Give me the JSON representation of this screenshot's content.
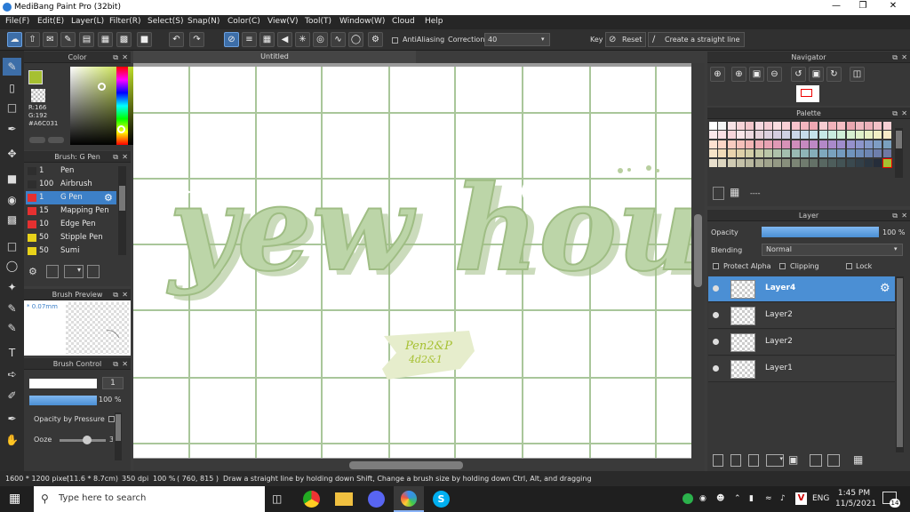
{
  "window": {
    "title": "MediBang Paint Pro (32bit)"
  },
  "menu": [
    "File(F)",
    "Edit(E)",
    "Layer(L)",
    "Filter(R)",
    "Select(S)",
    "Snap(N)",
    "Color(C)",
    "View(V)",
    "Tool(T)",
    "Window(W)",
    "Cloud",
    "Help"
  ],
  "toolbar": {
    "antialiasing_label": "AntiAliasing",
    "correction_label": "Correction",
    "correction_value": "40",
    "key_label": "Key",
    "reset_label": "Reset",
    "straight_line_label": "Create a straight line"
  },
  "color_panel": {
    "title": "Color",
    "r": "R:166",
    "g": "G:192",
    "hex": "#A6C031",
    "current_color": "#a6c031"
  },
  "brush_panel": {
    "title": "Brush: G Pen",
    "items": [
      {
        "size": "1",
        "name": "Pen",
        "color": "#2e2e2e"
      },
      {
        "size": "100",
        "name": "Airbrush",
        "color": "#2e2e2e"
      },
      {
        "size": "1",
        "name": "G Pen",
        "color": "#e53030"
      },
      {
        "size": "15",
        "name": "Mapping Pen",
        "color": "#e53030"
      },
      {
        "size": "10",
        "name": "Edge Pen",
        "color": "#e53030"
      },
      {
        "size": "50",
        "name": "Stipple Pen",
        "color": "#e8d21a"
      },
      {
        "size": "50",
        "name": "Sumi",
        "color": "#e8d21a"
      }
    ]
  },
  "brush_preview": {
    "title": "Brush Preview",
    "size": "* 0.07mm"
  },
  "brush_control": {
    "title": "Brush Control",
    "size_value": "1",
    "opacity_value": "100 %",
    "opacity_pressure_label": "Opacity by Pressure",
    "ooze_label": "Ooze",
    "ooze_value": "3"
  },
  "document": {
    "tab_title": "Untitled",
    "artwork_text": "yew hou",
    "sticker_line1": "Pen2&P",
    "sticker_line2": "4d2&1"
  },
  "navigator": {
    "title": "Navigator"
  },
  "palette": {
    "title": "Palette",
    "dash": "----",
    "colors": [
      "#ffffff",
      "#f4f4f4",
      "#f8e3e6",
      "#f7d4d8",
      "#f3c6cb",
      "#f6d8e0",
      "#f4ccd4",
      "#fadce0",
      "#f9d0d6",
      "#f7c4cc",
      "#f3b6bf",
      "#f0a8b3",
      "#f8cdd2",
      "#f2b3bb",
      "#f5bec4",
      "#eaa7b0",
      "#f0b8c0",
      "#ecb0b9",
      "#f2c1c7",
      "#f6cfd4",
      "#fbe8ea",
      "#f9dfe3",
      "#f6d5da",
      "#f9e6e9",
      "#ecd9df",
      "#e4d2da",
      "#dcd0de",
      "#d5cde0",
      "#cfd2e3",
      "#cbd7e8",
      "#c7dcea",
      "#c5e2eb",
      "#c5e7e6",
      "#c9ebdf",
      "#cfeed7",
      "#d6efcf",
      "#dff0c9",
      "#e9f0c5",
      "#f2efc4",
      "#f7ebc7",
      "#fde2d1",
      "#fbd6c7",
      "#f8cbc0",
      "#f5c0ba",
      "#f2b5b4",
      "#edabb3",
      "#e8a2b3",
      "#e099b5",
      "#d892b8",
      "#cf8dbc",
      "#c68ac0",
      "#bd88c4",
      "#b388c8",
      "#a98acb",
      "#9f8dcc",
      "#9591cc",
      "#8c95cb",
      "#8499c8",
      "#7e9dc4",
      "#7aa1bf",
      "#f7e4c8",
      "#f1dbb8",
      "#e9d3ad",
      "#ded0a8",
      "#d2cda6",
      "#c6c9a6",
      "#bac6a8",
      "#aec2ab",
      "#a3beaf",
      "#99b9b3",
      "#8fb4b7",
      "#86aeba",
      "#7fa8bd",
      "#79a1be",
      "#749abe",
      "#7093bc",
      "#6e8cb8",
      "#6d85b2",
      "#6e7eab",
      "#7078a3",
      "#e8dfcc",
      "#dcd5bf",
      "#d0cbb3",
      "#c4c1a8",
      "#b8b79e",
      "#acad95",
      "#a0a38c",
      "#949984",
      "#888f7c",
      "#7c8575",
      "#707b6e",
      "#647167",
      "#586761",
      "#4d5d5b",
      "#435355",
      "#3a494f",
      "#323f48",
      "#2b3641",
      "#252d3a",
      "#a6c031"
    ]
  },
  "layer_panel": {
    "title": "Layer",
    "opacity_label": "Opacity",
    "opacity_value": "100 %",
    "blending_label": "Blending",
    "blending_value": "Normal",
    "protect_alpha_label": "Protect Alpha",
    "clipping_label": "Clipping",
    "lock_label": "Lock",
    "layers": [
      "Layer4",
      "Layer2",
      "Layer2",
      "Layer1"
    ]
  },
  "statusbar": {
    "size": "1600 * 1200 pixel",
    "dims": "(11.6 * 8.7cm)",
    "dpi": "350 dpi",
    "zoom": "100 %",
    "coords": "( 760, 815 )",
    "hint": "Draw a straight line by holding down Shift, Change a brush size by holding down Ctrl, Alt, and dragging"
  },
  "taskbar": {
    "search_placeholder": "Type here to search",
    "lang": "ENG",
    "time": "1:45 PM",
    "date": "11/5/2021",
    "notifications": "14"
  }
}
